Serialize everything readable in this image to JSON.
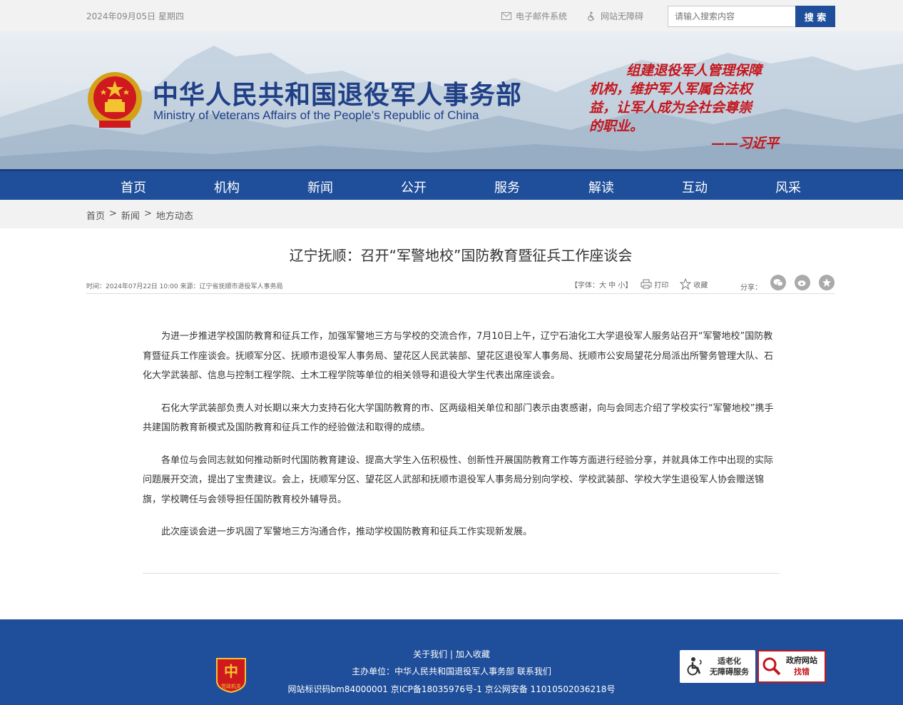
{
  "topbar": {
    "date": "2024年09月05日 星期四",
    "email_link": "电子邮件系统",
    "accessibility_link": "网站无障碍",
    "search_placeholder": "请输入搜索内容",
    "search_button": "搜 索"
  },
  "header": {
    "title_cn": "中华人民共和国退役军人事务部",
    "title_en": "Ministry of Veterans Affairs of the People's Republic of China",
    "quote_lines": [
      "组建退役军人管理保障",
      "机构，维护军人军属合法权",
      "益，让军人成为全社会尊崇",
      "的职业。"
    ],
    "quote_author": "——习近平"
  },
  "nav": {
    "items": [
      "首页",
      "机构",
      "新闻",
      "公开",
      "服务",
      "解读",
      "互动",
      "风采"
    ]
  },
  "breadcrumb": {
    "items": [
      "首页",
      ">",
      "新闻",
      ">",
      "地方动态"
    ]
  },
  "article": {
    "title": "辽宁抚顺：召开“军警地校”国防教育暨征兵工作座谈会",
    "meta": "时间：2024年07月22日  10:00  来源：辽宁省抚顺市退役军人事务局",
    "font_size_label": "【字体：大  中  小】",
    "print_label": "打印",
    "favorite_label": "收藏",
    "share_label": "分享：",
    "paragraphs": [
      "为进一步推进学校国防教育和征兵工作，加强军警地三方与学校的交流合作，7月10日上午，辽宁石油化工大学退役军人服务站召开“军警地校”国防教育暨征兵工作座谈会。抚顺军分区、抚顺市退役军人事务局、望花区人民武装部、望花区退役军人事务局、抚顺市公安局望花分局派出所警务管理大队、石化大学武装部、信息与控制工程学院、土木工程学院等单位的相关领导和退役大学生代表出席座谈会。",
      "石化大学武装部负责人对长期以来大力支持石化大学国防教育的市、区两级相关单位和部门表示由衷感谢，向与会同志介绍了学校实行“军警地校”携手共建国防教育新模式及国防教育和征兵工作的经验做法和取得的成绩。",
      "各单位与会同志就如何推动新时代国防教育建设、提高大学生入伍积极性、创新性开展国防教育工作等方面进行经验分享，并就具体工作中出现的实际问题展开交流，提出了宝贵建议。会上，抚顺军分区、望花区人武部和抚顺市退役军人事务局分别向学校、学校武装部、学校大学生退役军人协会赠送锦旗，学校聘任与会领导担任国防教育校外辅导员。",
      "此次座谈会进一步巩固了军警地三方沟通合作，推动学校国防教育和征兵工作实现新发展。"
    ]
  },
  "footer": {
    "links": "关于我们 | 加入收藏",
    "org": "主办单位：中华人民共和国退役军人事务部    联系我们",
    "icp": "网站标识码bm84000001 京ICP备18035976号-1  京公网安备 11010502036218号",
    "party_badge_text": "党政机关",
    "aged_badge_lines": [
      "适老化",
      "无障碍服务"
    ],
    "gov_badge_lines": [
      "政府网站",
      "找错"
    ]
  },
  "colors": {
    "brand_blue": "#1f4e9a",
    "quote_red": "#c4161c"
  }
}
